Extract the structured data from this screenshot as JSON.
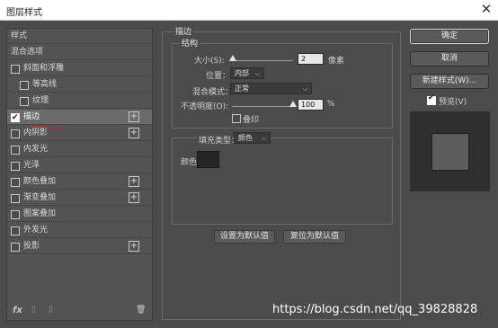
{
  "window": {
    "title": "图层样式",
    "close_glyph": "✕"
  },
  "left_panel": {
    "items": [
      {
        "label": "样式",
        "checkbox": false,
        "checked": false,
        "plus": false,
        "indent": 0
      },
      {
        "label": "混合选项",
        "checkbox": false,
        "checked": false,
        "plus": false,
        "indent": 0
      },
      {
        "label": "斜面和浮雕",
        "checkbox": true,
        "checked": false,
        "plus": false,
        "indent": 0
      },
      {
        "label": "等高线",
        "checkbox": true,
        "checked": false,
        "plus": false,
        "indent": 1
      },
      {
        "label": "纹理",
        "checkbox": true,
        "checked": false,
        "plus": false,
        "indent": 1
      },
      {
        "label": "描边",
        "checkbox": true,
        "checked": true,
        "plus": true,
        "indent": 0,
        "selected": true
      },
      {
        "label": "内阴影",
        "checkbox": true,
        "checked": false,
        "plus": true,
        "indent": 0
      },
      {
        "label": "内发光",
        "checkbox": true,
        "checked": false,
        "plus": false,
        "indent": 0
      },
      {
        "label": "光泽",
        "checkbox": true,
        "checked": false,
        "plus": false,
        "indent": 0
      },
      {
        "label": "颜色叠加",
        "checkbox": true,
        "checked": false,
        "plus": true,
        "indent": 0
      },
      {
        "label": "渐变叠加",
        "checkbox": true,
        "checked": false,
        "plus": true,
        "indent": 0
      },
      {
        "label": "图案叠加",
        "checkbox": true,
        "checked": false,
        "plus": false,
        "indent": 0
      },
      {
        "label": "外发光",
        "checkbox": true,
        "checked": false,
        "plus": false,
        "indent": 0
      },
      {
        "label": "投影",
        "checkbox": true,
        "checked": false,
        "plus": true,
        "indent": 0
      }
    ],
    "fx_label": "fx",
    "up_glyph": "⇧",
    "down_glyph": "⇩",
    "trash_glyph": "🗑"
  },
  "stroke": {
    "group_title": "描边",
    "structure_title": "结构",
    "size_label": "大小(S):",
    "size_value": "2",
    "size_unit": "像素",
    "size_slider_fraction": 0.02,
    "position_label": "位置：",
    "position_value": "内部",
    "blend_label": "混合模式：",
    "blend_value": "正常",
    "opacity_label": "不透明度(O):",
    "opacity_value": "100",
    "opacity_unit": "%",
    "opacity_slider_fraction": 1.0,
    "overprint_label": "叠印",
    "fill_type_label": "填充类型：",
    "fill_type_value": "颜色",
    "color_label": "颜色：",
    "color_swatch": "#262626",
    "set_default_button": "设置为默认值",
    "reset_default_button": "复位为默认值"
  },
  "actions": {
    "ok": "确定",
    "cancel": "取消",
    "new_style": "新建样式(W)...",
    "preview_label": "预览(V)",
    "preview_checked": true
  },
  "watermark": "https://blog.csdn.net/qq_39828828"
}
